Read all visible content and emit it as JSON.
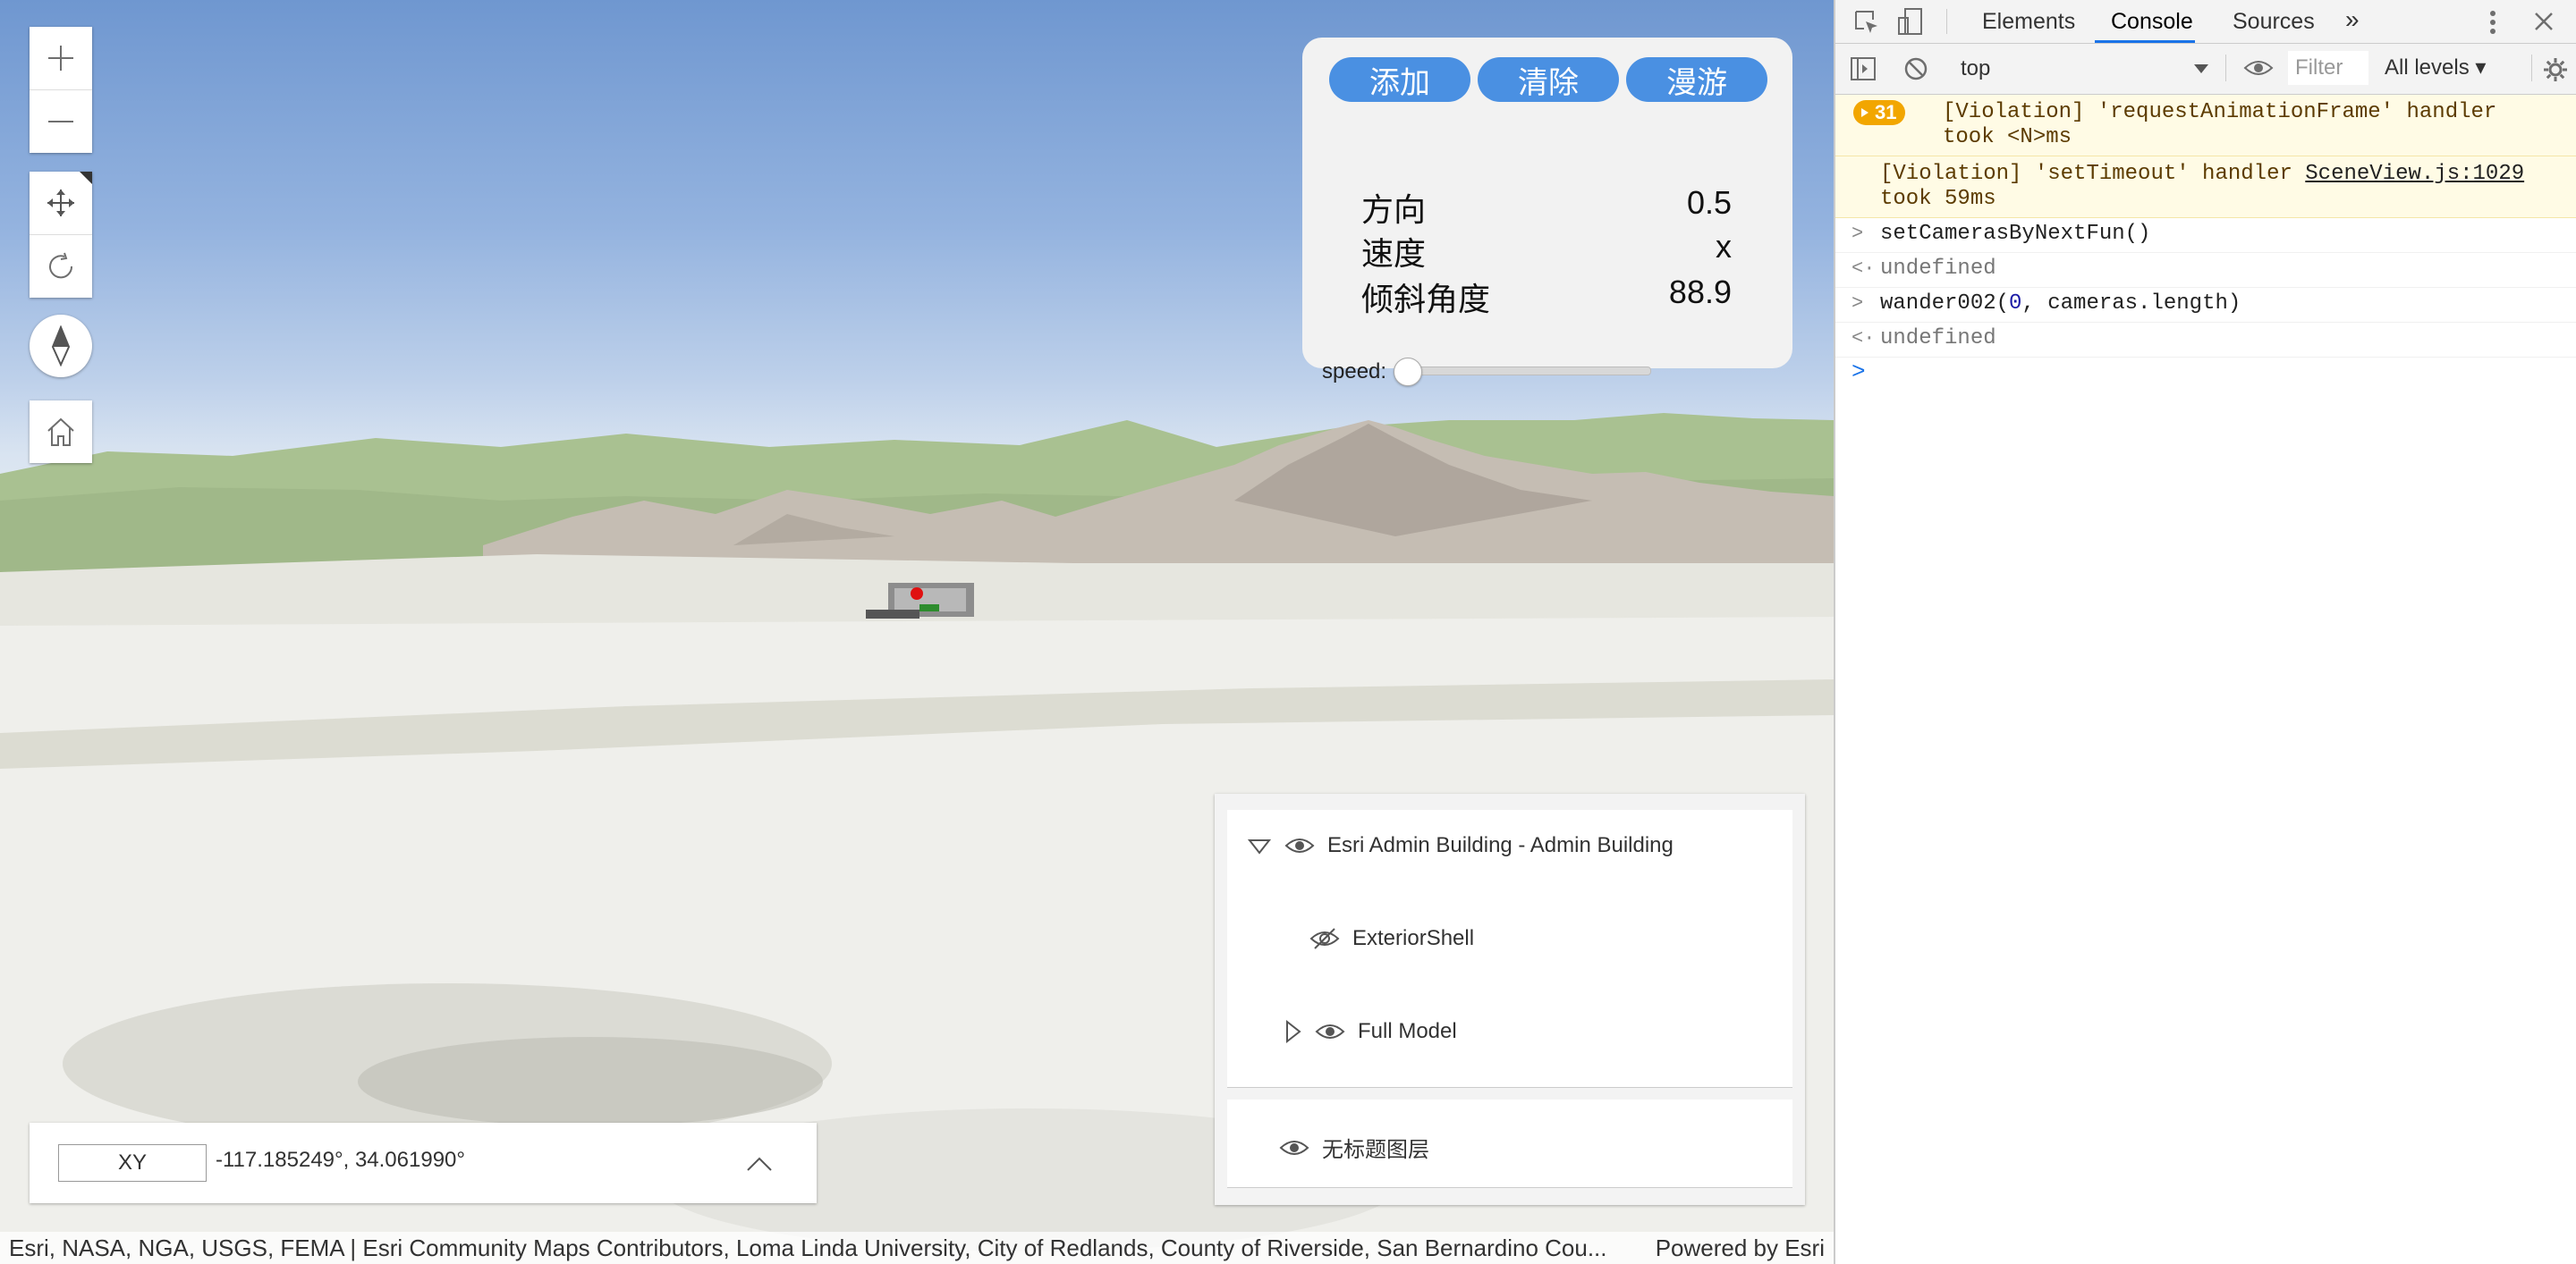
{
  "scene": {
    "navigation": {
      "zoom_in_icon": "plus-icon",
      "zoom_out_icon": "minus-icon",
      "pan_icon": "move-icon",
      "rotate_icon": "rotate-icon",
      "compass_icon": "compass-icon",
      "home_icon": "home-icon"
    },
    "toolpanel": {
      "buttons": [
        "添加",
        "清除",
        "漫游"
      ],
      "rows": [
        {
          "label": "方向",
          "value": "0.5"
        },
        {
          "label": "速度",
          "value": "x"
        },
        {
          "label": "倾斜角度",
          "value": "88.9"
        }
      ],
      "speed_label": "speed:",
      "speed_fraction": 0.0,
      "accent_color": "#4a90e2"
    },
    "layerlist": {
      "group": "Esri Admin Building - Admin Building",
      "children": [
        "ExteriorShell",
        "Full Model"
      ],
      "second_layer": "无标题图层"
    },
    "coords": {
      "format": "XY",
      "value": "-117.185249°, 34.061990°"
    },
    "attribution": {
      "text": "Esri, NASA, NGA, USGS, FEMA | Esri Community Maps Contributors, Loma Linda University, City of Redlands, County of Riverside, San Bernardino Cou...",
      "powered": "Powered by Esri"
    }
  },
  "devtools": {
    "tabs": [
      "Elements",
      "Console",
      "Sources"
    ],
    "active_tab": "Console",
    "more_tabs": "»",
    "context": "top",
    "filter_placeholder": "Filter",
    "levels": "All levels ▾",
    "messages": [
      {
        "badge": "31",
        "text1": "[Violation] 'requestAnimationFrame' handler",
        "text2": "took <N>ms"
      },
      {
        "text1a": "[Violation] 'setTimeout' handler ",
        "link": "SceneView.js:1029",
        "text2": "took 59ms"
      }
    ],
    "input1": "setCamerasByNextFun()",
    "result1": "undefined",
    "input2_fn": "wander002(",
    "input2_num": "0",
    "input2_rest": ", cameras.length)",
    "result2": "undefined"
  }
}
